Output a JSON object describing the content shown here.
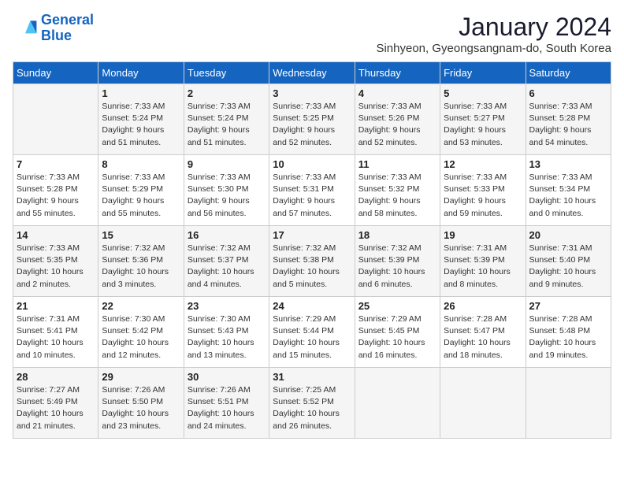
{
  "logo": {
    "line1": "General",
    "line2": "Blue"
  },
  "title": "January 2024",
  "subtitle": "Sinhyeon, Gyeongsangnam-do, South Korea",
  "weekdays": [
    "Sunday",
    "Monday",
    "Tuesday",
    "Wednesday",
    "Thursday",
    "Friday",
    "Saturday"
  ],
  "weeks": [
    [
      {
        "day": "",
        "info": ""
      },
      {
        "day": "1",
        "info": "Sunrise: 7:33 AM\nSunset: 5:24 PM\nDaylight: 9 hours\nand 51 minutes."
      },
      {
        "day": "2",
        "info": "Sunrise: 7:33 AM\nSunset: 5:24 PM\nDaylight: 9 hours\nand 51 minutes."
      },
      {
        "day": "3",
        "info": "Sunrise: 7:33 AM\nSunset: 5:25 PM\nDaylight: 9 hours\nand 52 minutes."
      },
      {
        "day": "4",
        "info": "Sunrise: 7:33 AM\nSunset: 5:26 PM\nDaylight: 9 hours\nand 52 minutes."
      },
      {
        "day": "5",
        "info": "Sunrise: 7:33 AM\nSunset: 5:27 PM\nDaylight: 9 hours\nand 53 minutes."
      },
      {
        "day": "6",
        "info": "Sunrise: 7:33 AM\nSunset: 5:28 PM\nDaylight: 9 hours\nand 54 minutes."
      }
    ],
    [
      {
        "day": "7",
        "info": "Sunrise: 7:33 AM\nSunset: 5:28 PM\nDaylight: 9 hours\nand 55 minutes."
      },
      {
        "day": "8",
        "info": "Sunrise: 7:33 AM\nSunset: 5:29 PM\nDaylight: 9 hours\nand 55 minutes."
      },
      {
        "day": "9",
        "info": "Sunrise: 7:33 AM\nSunset: 5:30 PM\nDaylight: 9 hours\nand 56 minutes."
      },
      {
        "day": "10",
        "info": "Sunrise: 7:33 AM\nSunset: 5:31 PM\nDaylight: 9 hours\nand 57 minutes."
      },
      {
        "day": "11",
        "info": "Sunrise: 7:33 AM\nSunset: 5:32 PM\nDaylight: 9 hours\nand 58 minutes."
      },
      {
        "day": "12",
        "info": "Sunrise: 7:33 AM\nSunset: 5:33 PM\nDaylight: 9 hours\nand 59 minutes."
      },
      {
        "day": "13",
        "info": "Sunrise: 7:33 AM\nSunset: 5:34 PM\nDaylight: 10 hours\nand 0 minutes."
      }
    ],
    [
      {
        "day": "14",
        "info": "Sunrise: 7:33 AM\nSunset: 5:35 PM\nDaylight: 10 hours\nand 2 minutes."
      },
      {
        "day": "15",
        "info": "Sunrise: 7:32 AM\nSunset: 5:36 PM\nDaylight: 10 hours\nand 3 minutes."
      },
      {
        "day": "16",
        "info": "Sunrise: 7:32 AM\nSunset: 5:37 PM\nDaylight: 10 hours\nand 4 minutes."
      },
      {
        "day": "17",
        "info": "Sunrise: 7:32 AM\nSunset: 5:38 PM\nDaylight: 10 hours\nand 5 minutes."
      },
      {
        "day": "18",
        "info": "Sunrise: 7:32 AM\nSunset: 5:39 PM\nDaylight: 10 hours\nand 6 minutes."
      },
      {
        "day": "19",
        "info": "Sunrise: 7:31 AM\nSunset: 5:39 PM\nDaylight: 10 hours\nand 8 minutes."
      },
      {
        "day": "20",
        "info": "Sunrise: 7:31 AM\nSunset: 5:40 PM\nDaylight: 10 hours\nand 9 minutes."
      }
    ],
    [
      {
        "day": "21",
        "info": "Sunrise: 7:31 AM\nSunset: 5:41 PM\nDaylight: 10 hours\nand 10 minutes."
      },
      {
        "day": "22",
        "info": "Sunrise: 7:30 AM\nSunset: 5:42 PM\nDaylight: 10 hours\nand 12 minutes."
      },
      {
        "day": "23",
        "info": "Sunrise: 7:30 AM\nSunset: 5:43 PM\nDaylight: 10 hours\nand 13 minutes."
      },
      {
        "day": "24",
        "info": "Sunrise: 7:29 AM\nSunset: 5:44 PM\nDaylight: 10 hours\nand 15 minutes."
      },
      {
        "day": "25",
        "info": "Sunrise: 7:29 AM\nSunset: 5:45 PM\nDaylight: 10 hours\nand 16 minutes."
      },
      {
        "day": "26",
        "info": "Sunrise: 7:28 AM\nSunset: 5:47 PM\nDaylight: 10 hours\nand 18 minutes."
      },
      {
        "day": "27",
        "info": "Sunrise: 7:28 AM\nSunset: 5:48 PM\nDaylight: 10 hours\nand 19 minutes."
      }
    ],
    [
      {
        "day": "28",
        "info": "Sunrise: 7:27 AM\nSunset: 5:49 PM\nDaylight: 10 hours\nand 21 minutes."
      },
      {
        "day": "29",
        "info": "Sunrise: 7:26 AM\nSunset: 5:50 PM\nDaylight: 10 hours\nand 23 minutes."
      },
      {
        "day": "30",
        "info": "Sunrise: 7:26 AM\nSunset: 5:51 PM\nDaylight: 10 hours\nand 24 minutes."
      },
      {
        "day": "31",
        "info": "Sunrise: 7:25 AM\nSunset: 5:52 PM\nDaylight: 10 hours\nand 26 minutes."
      },
      {
        "day": "",
        "info": ""
      },
      {
        "day": "",
        "info": ""
      },
      {
        "day": "",
        "info": ""
      }
    ]
  ]
}
